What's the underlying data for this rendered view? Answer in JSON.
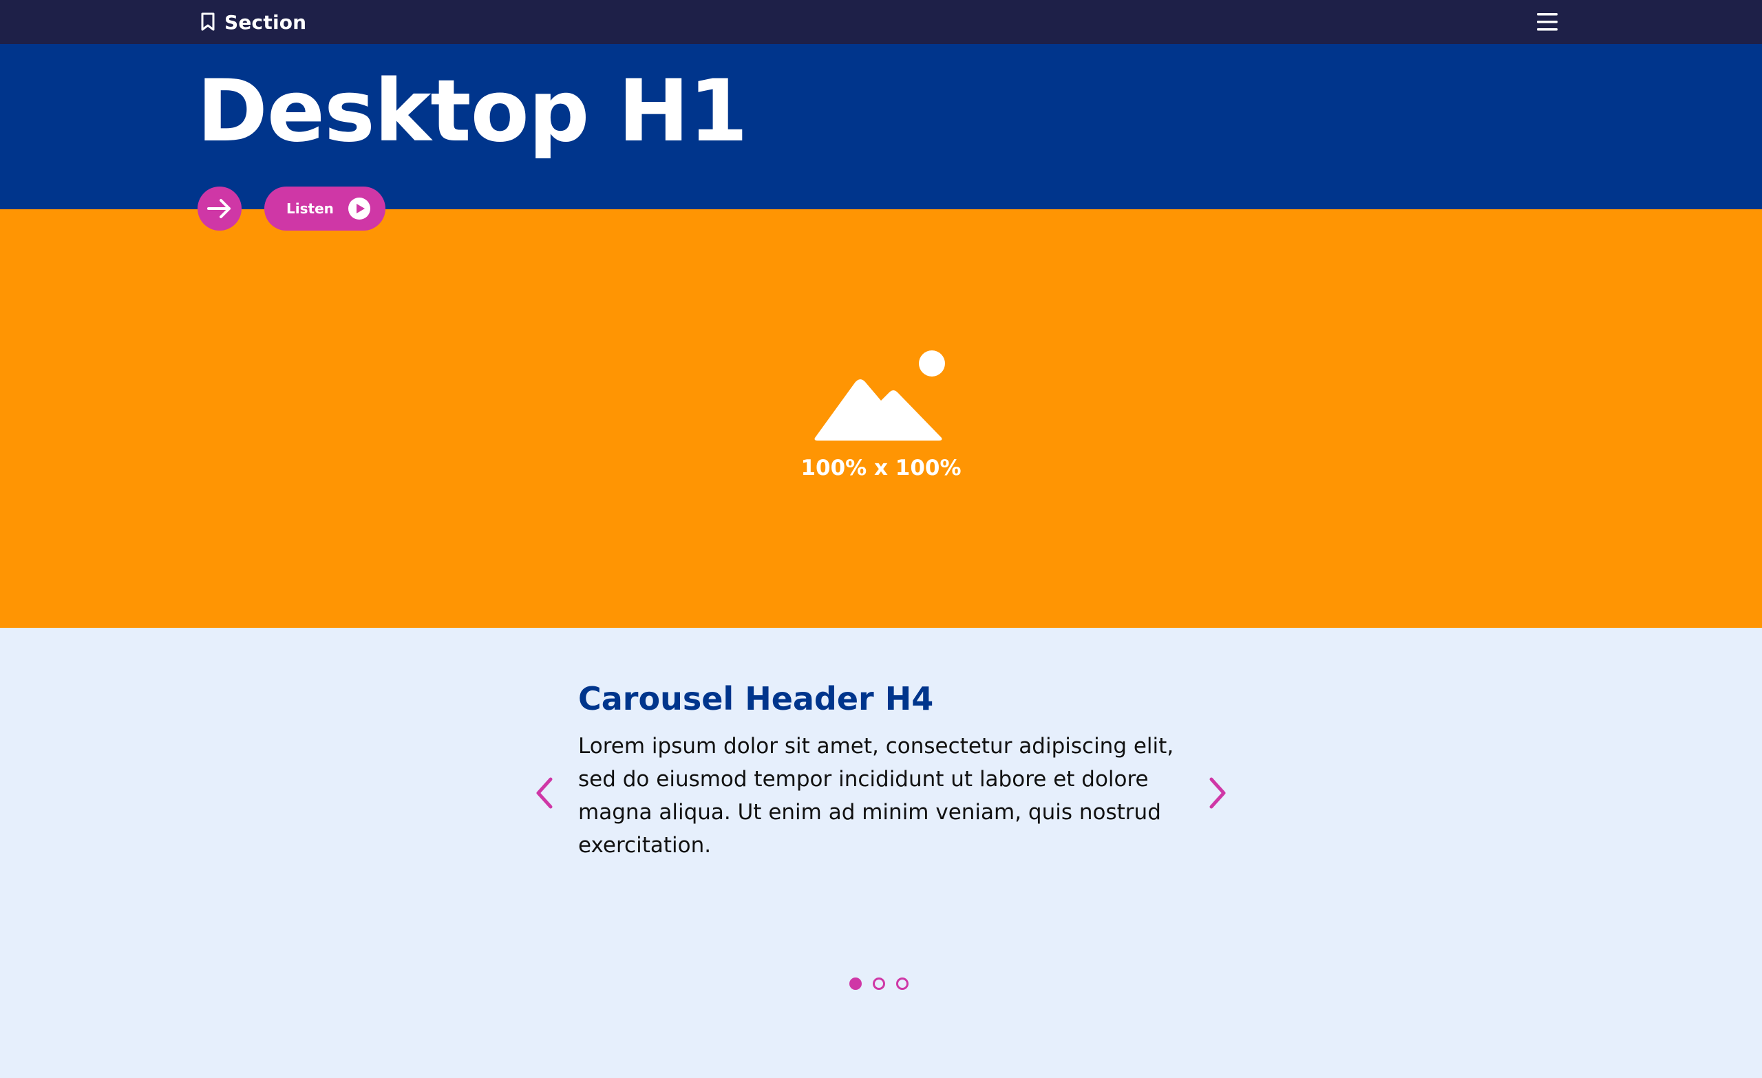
{
  "colors": {
    "topbar": "#1e2048",
    "hero": "#00358c",
    "image_area": "#ff9503",
    "accent": "#cf37a6",
    "carousel_bg": "#e6effc",
    "carousel_title": "#00358c"
  },
  "topbar": {
    "section_label": "Section",
    "section_icon": "bookmark-icon",
    "menu_icon": "hamburger-menu-icon"
  },
  "hero": {
    "title": "Desktop H1",
    "arrow_icon": "arrow-right-icon",
    "listen_label": "Listen",
    "listen_icon": "play-circle-icon"
  },
  "image_placeholder": {
    "icon": "image-placeholder-icon",
    "label": "100% x 100%"
  },
  "carousel": {
    "title": "Carousel Header H4",
    "text": "Lorem ipsum dolor sit amet, consectetur adipiscing elit, sed do eiusmod tempor incididunt ut labore et dolore magna aliqua. Ut enim ad minim veniam, quis nostrud exercitation.",
    "prev_icon": "chevron-left-icon",
    "next_icon": "chevron-right-icon",
    "slide_count": 3,
    "active_slide": 1
  }
}
